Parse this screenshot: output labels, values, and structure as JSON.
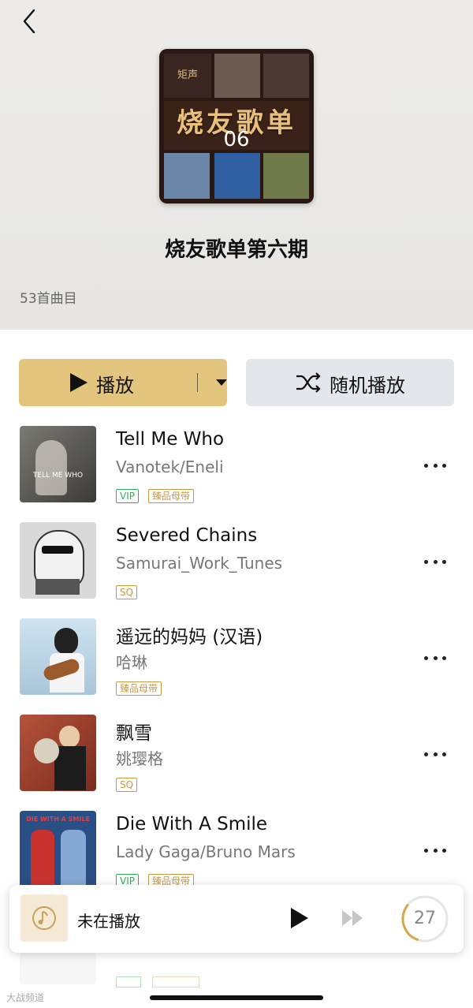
{
  "header": {
    "back_icon": "chevron-left-icon",
    "cover_brand": "矩声",
    "cover_title": "烧友歌单",
    "cover_number": "06",
    "playlist_title": "烧友歌单第六期",
    "track_count": "53首曲目"
  },
  "actions": {
    "play_label": "播放",
    "shuffle_label": "随机播放",
    "play_color": "#e3c57d",
    "shuffle_color": "#e3e6ea"
  },
  "tracks": [
    {
      "title": "Tell Me Who",
      "artist": "Vanotek/Eneli",
      "badges": [
        "VIP",
        "臻品母带"
      ],
      "art_text": "TELL ME WHO"
    },
    {
      "title": "Severed Chains",
      "artist": "Samurai_Work_Tunes",
      "badges": [
        "SQ"
      ],
      "art_text": ""
    },
    {
      "title": "遥远的妈妈 (汉语)",
      "artist": "哈琳",
      "badges": [
        "臻品母带"
      ],
      "art_text": ""
    },
    {
      "title": "飘雪",
      "artist": "姚璎格",
      "badges": [
        "SQ"
      ],
      "art_text": ""
    },
    {
      "title": "Die With A Smile",
      "artist": "Lady Gaga/Bruno Mars",
      "badges": [
        "VIP",
        "臻品母带"
      ],
      "art_text": "DIE WITH A SMILE"
    }
  ],
  "player": {
    "status": "未在播放",
    "queue_count": "27",
    "queue_progress": 0.3
  },
  "watermark": "大战频道",
  "colors": {
    "vip": "#2fb15a",
    "gold": "#c99a3d"
  }
}
